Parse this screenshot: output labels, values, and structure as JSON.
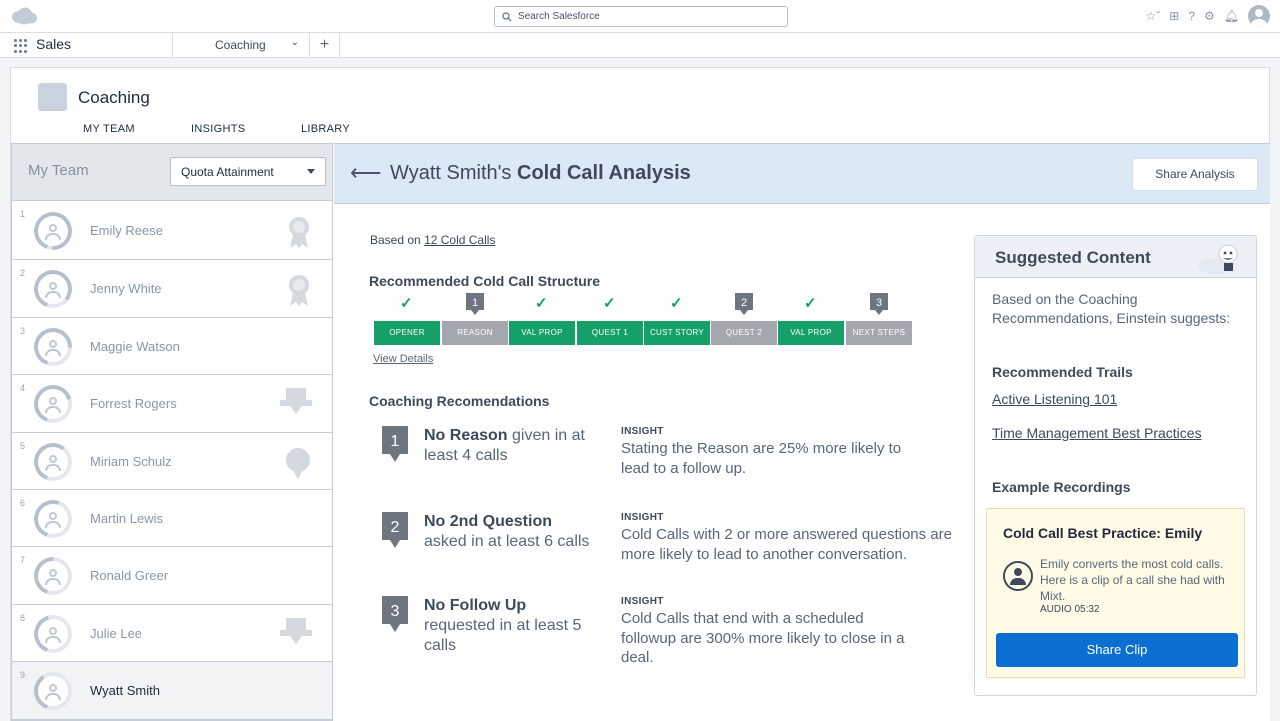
{
  "header": {
    "search_placeholder": "Search Salesforce"
  },
  "nav": {
    "app_name": "Sales",
    "tab_label": "Coaching",
    "add_tab": "+"
  },
  "page": {
    "title": "Coaching",
    "tabs": [
      "MY TEAM",
      "INSIGHTS",
      "LIBRARY"
    ]
  },
  "team": {
    "title": "My Team",
    "sort_value": "Quota Attainment",
    "members": [
      {
        "rank": "1",
        "name": "Emily Reese",
        "attainment": 0.95,
        "badge": "ribbon-icon"
      },
      {
        "rank": "2",
        "name": "Jenny White",
        "attainment": 0.8,
        "badge": "ribbon-icon"
      },
      {
        "rank": "3",
        "name": "Maggie Watson",
        "attainment": 0.7,
        "badge": ""
      },
      {
        "rank": "4",
        "name": "Forrest Rogers",
        "attainment": 0.65,
        "badge": "trophy-icon"
      },
      {
        "rank": "5",
        "name": "Miriam Schulz",
        "attainment": 0.55,
        "badge": "medal-icon"
      },
      {
        "rank": "6",
        "name": "Martin Lewis",
        "attainment": 0.5,
        "badge": ""
      },
      {
        "rank": "7",
        "name": "Ronald Greer",
        "attainment": 0.45,
        "badge": ""
      },
      {
        "rank": "8",
        "name": "Julie Lee",
        "attainment": 0.4,
        "badge": "trophy-icon"
      },
      {
        "rank": "9",
        "name": "Wyatt Smith",
        "attainment": 0.35,
        "badge": ""
      }
    ]
  },
  "analysis": {
    "title_prefix": "Wyatt Smith's",
    "title_bold": "Cold Call Analysis",
    "share_label": "Share Analysis",
    "based_prefix": "Based on",
    "based_link": "12 Cold Calls",
    "structure_heading": "Recommended Cold Call Structure",
    "steps": [
      {
        "label": "OPENER",
        "status": "ok",
        "marker": ""
      },
      {
        "label": "REASON",
        "status": "bad",
        "marker": "1"
      },
      {
        "label": "VAL PROP",
        "status": "ok",
        "marker": ""
      },
      {
        "label": "QUEST 1",
        "status": "ok",
        "marker": ""
      },
      {
        "label": "CUST STORY",
        "status": "ok",
        "marker": ""
      },
      {
        "label": "QUEST 2",
        "status": "bad",
        "marker": "2"
      },
      {
        "label": "VAL PROP",
        "status": "ok",
        "marker": ""
      },
      {
        "label": "NEXT STEPS",
        "status": "bad",
        "marker": "3"
      }
    ],
    "view_details": "View Details",
    "coaching_heading": "Coaching Recomendations",
    "recommendations": [
      {
        "num": "1",
        "bold": "No Reason",
        "rest_line1": " given in at",
        "rest_line2": "least 4 calls",
        "insight_label": "INSIGHT",
        "insight": "Stating the Reason are 25% more likely to lead to a follow up."
      },
      {
        "num": "2",
        "bold": "No 2nd Question",
        "rest_line1": "",
        "rest_line2": "asked in at least 6 calls",
        "insight_label": "INSIGHT",
        "insight": "Cold Calls with 2 or more answered questions are more likely to lead to another conversation."
      },
      {
        "num": "3",
        "bold": "No Follow Up",
        "rest_line1": "",
        "rest_line2": "requested in at least 5 calls",
        "insight_label": "INSIGHT",
        "insight": "Cold Calls that end with a scheduled followup are 300% more likely to close in a deal."
      }
    ]
  },
  "suggested": {
    "title": "Suggested Content",
    "intro": "Based on the Coaching Recommendations, Einstein suggests:",
    "trails_heading": "Recommended Trails",
    "trails": [
      "Active Listening 101",
      "Time Management Best Practices"
    ],
    "recordings_heading": "Example Recordings",
    "recording": {
      "title": "Cold Call Best Practice: Emily",
      "text": "Emily converts the most cold calls. Here is a clip of a call she had with Mixt.",
      "audio": "AUDIO 05:32",
      "button": "Share Clip"
    }
  },
  "colors": {
    "ok": "#14a067",
    "bad": "#a4a8ae",
    "brand": "#0b6fd1",
    "header_band": "#dbe8f6"
  }
}
